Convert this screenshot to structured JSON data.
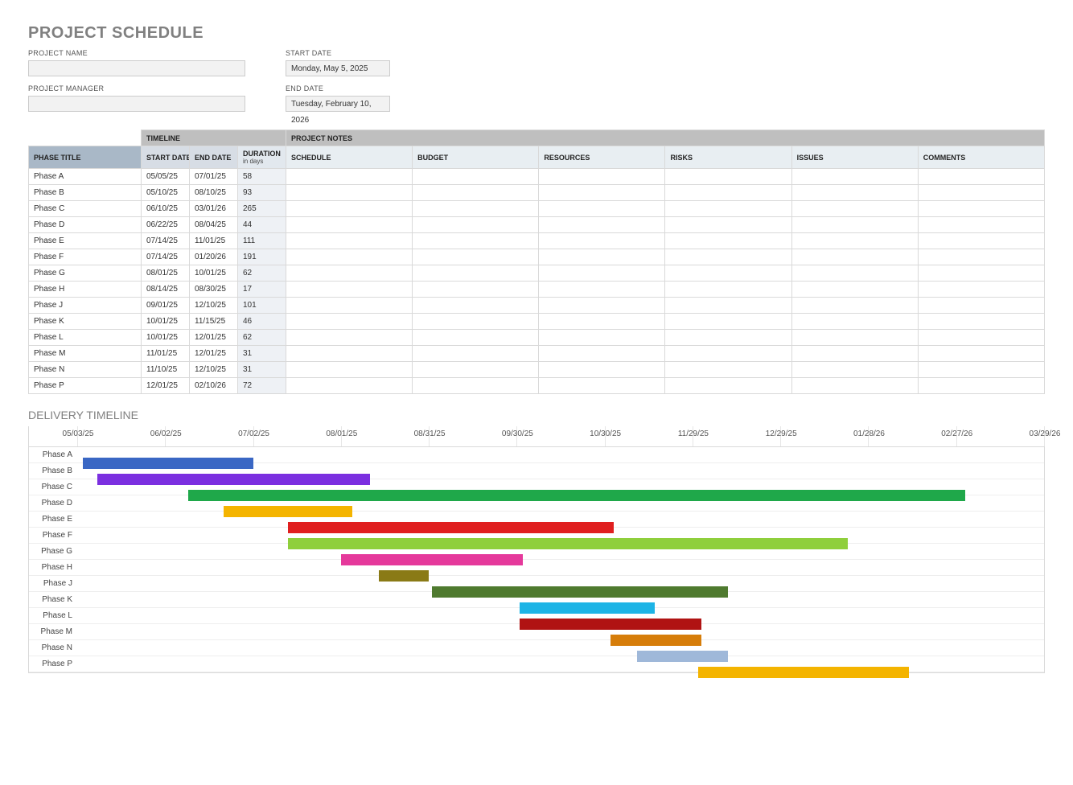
{
  "title": "PROJECT SCHEDULE",
  "delivery_title": "DELIVERY TIMELINE",
  "fields": {
    "project_name_label": "PROJECT NAME",
    "project_name_value": "",
    "project_manager_label": "PROJECT MANAGER",
    "project_manager_value": "",
    "start_date_label": "START DATE",
    "start_date_value": "Monday, May 5, 2025",
    "end_date_label": "END DATE",
    "end_date_value": "Tuesday, February 10, 2026"
  },
  "headers": {
    "phase_title": "PHASE TITLE",
    "timeline": "TIMELINE",
    "start_date": "START DATE",
    "end_date": "END DATE",
    "duration": "DURATION",
    "duration_sub": "in days",
    "project_notes": "PROJECT NOTES",
    "schedule": "SCHEDULE",
    "budget": "BUDGET",
    "resources": "RESOURCES",
    "risks": "RISKS",
    "issues": "ISSUES",
    "comments": "COMMENTS"
  },
  "phases": [
    {
      "title": "Phase A",
      "start": "05/05/25",
      "end": "07/01/25",
      "duration": 58,
      "color": "#3a67c4"
    },
    {
      "title": "Phase B",
      "start": "05/10/25",
      "end": "08/10/25",
      "duration": 93,
      "color": "#7b2fe0"
    },
    {
      "title": "Phase C",
      "start": "06/10/25",
      "end": "03/01/26",
      "duration": 265,
      "color": "#1fa84a"
    },
    {
      "title": "Phase D",
      "start": "06/22/25",
      "end": "08/04/25",
      "duration": 44,
      "color": "#f4b400"
    },
    {
      "title": "Phase E",
      "start": "07/14/25",
      "end": "11/01/25",
      "duration": 111,
      "color": "#e01f1f"
    },
    {
      "title": "Phase F",
      "start": "07/14/25",
      "end": "01/20/26",
      "duration": 191,
      "color": "#8fcf3c"
    },
    {
      "title": "Phase G",
      "start": "08/01/25",
      "end": "10/01/25",
      "duration": 62,
      "color": "#e5399b"
    },
    {
      "title": "Phase H",
      "start": "08/14/25",
      "end": "08/30/25",
      "duration": 17,
      "color": "#8a7a16"
    },
    {
      "title": "Phase J",
      "start": "09/01/25",
      "end": "12/10/25",
      "duration": 101,
      "color": "#4f7a2f"
    },
    {
      "title": "Phase K",
      "start": "10/01/25",
      "end": "11/15/25",
      "duration": 46,
      "color": "#1db4e6"
    },
    {
      "title": "Phase L",
      "start": "10/01/25",
      "end": "12/01/25",
      "duration": 62,
      "color": "#b01313"
    },
    {
      "title": "Phase M",
      "start": "11/01/25",
      "end": "12/01/25",
      "duration": 31,
      "color": "#d67d0a"
    },
    {
      "title": "Phase N",
      "start": "11/10/25",
      "end": "12/10/25",
      "duration": 31,
      "color": "#9fb8d9"
    },
    {
      "title": "Phase P",
      "start": "12/01/25",
      "end": "02/10/26",
      "duration": 72,
      "color": "#f4b400"
    }
  ],
  "chart_data": {
    "type": "bar",
    "title": "DELIVERY TIMELINE",
    "xlabel": "",
    "ylabel": "",
    "x_axis_dates": [
      "05/03/25",
      "06/02/25",
      "07/02/25",
      "08/01/25",
      "08/31/25",
      "09/30/25",
      "10/30/25",
      "11/29/25",
      "12/29/25",
      "01/28/26",
      "02/27/26",
      "03/29/26"
    ],
    "x_range_days": [
      0,
      330
    ],
    "categories": [
      "Phase A",
      "Phase B",
      "Phase C",
      "Phase D",
      "Phase E",
      "Phase F",
      "Phase G",
      "Phase H",
      "Phase J",
      "Phase K",
      "Phase L",
      "Phase M",
      "Phase N",
      "Phase P"
    ],
    "series": [
      {
        "name": "start_offset_days",
        "values": [
          2,
          7,
          38,
          50,
          72,
          72,
          90,
          103,
          121,
          151,
          151,
          182,
          191,
          212
        ]
      },
      {
        "name": "duration_days",
        "values": [
          58,
          93,
          265,
          44,
          111,
          191,
          62,
          17,
          101,
          46,
          62,
          31,
          31,
          72
        ]
      }
    ]
  }
}
